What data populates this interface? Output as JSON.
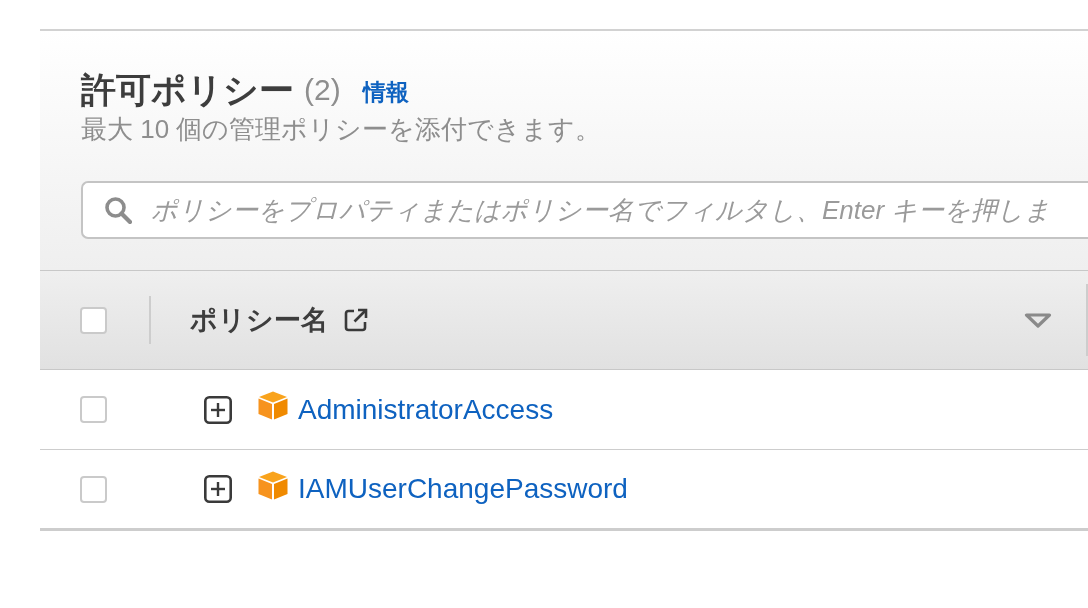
{
  "section": {
    "title": "許可ポリシー",
    "count": "(2)",
    "info_link": "情報",
    "description": "最大 10 個の管理ポリシーを添付できます。"
  },
  "search": {
    "placeholder": "ポリシーをプロパティまたはポリシー名でフィルタし、Enter キーを押しま"
  },
  "table": {
    "select_all": {
      "checked": false
    },
    "columns": [
      {
        "label": "ポリシー名"
      }
    ],
    "rows": [
      {
        "checked": false,
        "expanded": false,
        "name": "AdministratorAccess"
      },
      {
        "checked": false,
        "expanded": false,
        "name": "IAMUserChangePassword"
      }
    ]
  }
}
